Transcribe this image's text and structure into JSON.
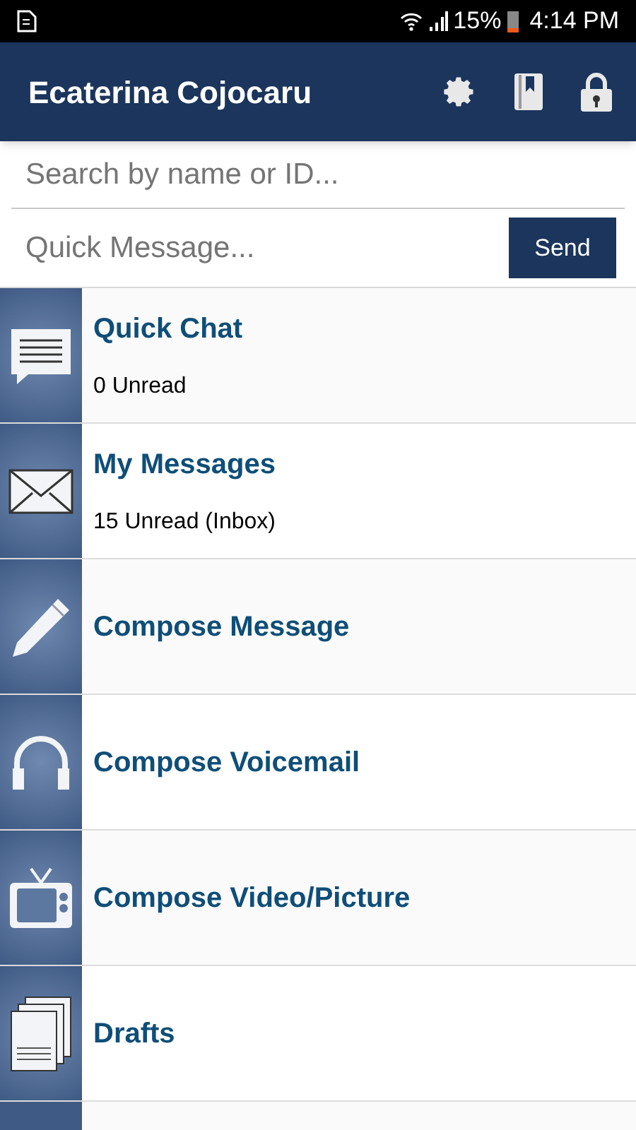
{
  "status_bar": {
    "battery": "15%",
    "time": "4:14 PM"
  },
  "header": {
    "title": "Ecaterina Cojocaru"
  },
  "search": {
    "placeholder": "Search by name or ID..."
  },
  "quick_message": {
    "placeholder": "Quick Message...",
    "button": "Send"
  },
  "menu": [
    {
      "kind": "chat",
      "title": "Quick Chat",
      "subtitle": "0 Unread"
    },
    {
      "kind": "mail",
      "title": "My Messages",
      "subtitle": "15 Unread (Inbox)"
    },
    {
      "kind": "pencil",
      "title": "Compose Message"
    },
    {
      "kind": "headphones",
      "title": "Compose Voicemail"
    },
    {
      "kind": "tv",
      "title": "Compose Video/Picture"
    },
    {
      "kind": "documents",
      "title": "Drafts"
    }
  ]
}
